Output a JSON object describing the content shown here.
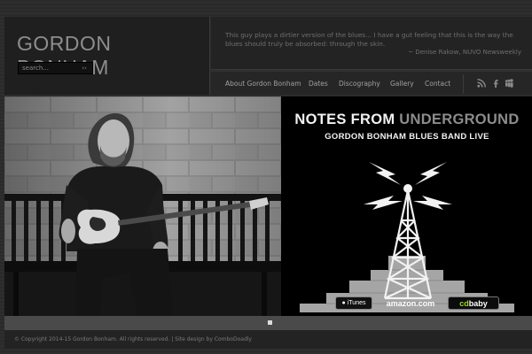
{
  "header": {
    "site_title": "GORDON BONHAM",
    "search_placeholder": "search...",
    "search_button": "››",
    "quote": "This guy plays a dirtier version of the blues... I have a gut feeling that this is the way the blues should truly be absorbed: through the skin.",
    "attribution": "~ Denise Rakow, NUVO Newsweekly"
  },
  "nav": {
    "items": [
      {
        "label": "About Gordon Bonham"
      },
      {
        "label": "Dates"
      },
      {
        "label": "Discography"
      },
      {
        "label": "Gallery"
      },
      {
        "label": "Contact"
      }
    ],
    "social_icons": [
      "rss-icon",
      "facebook-icon",
      "myspace-icon"
    ]
  },
  "slide": {
    "album_title_bright": "NOTES FROM",
    "album_title_dim": "UNDERGROUND",
    "album_subtitle": "GORDON BONHAM BLUES BAND LIVE",
    "stores": {
      "itunes": "iTunes",
      "amazon": "amazon.com",
      "cdbaby_prefix": "cd",
      "cdbaby_suffix": "baby"
    },
    "slide_count": 1,
    "active_slide": 1
  },
  "footer": {
    "copyright": "© Copyright 2014-15 Gordon Bonham. All rights reserved.  |  Site design by ComboDoadly"
  },
  "colors": {
    "page_bg": "#2b2b2b",
    "panel_bg": "#1f1f1f",
    "accent_green": "#9bd32b",
    "text_muted": "#7a7a7a"
  }
}
